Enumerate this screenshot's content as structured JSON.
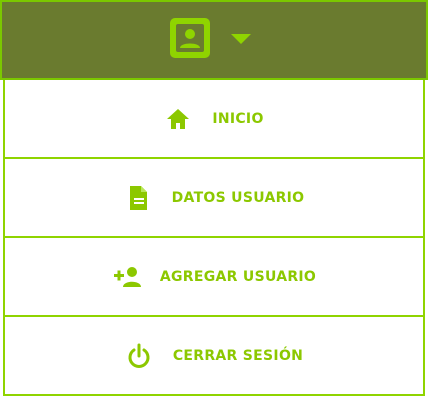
{
  "colors": {
    "header_bg": "#6a7b2f",
    "accent": "#8fd400",
    "label": "#8cc800",
    "background": "#ffffff"
  },
  "header": {
    "avatar_icon": "user-avatar-icon",
    "dropdown_icon": "chevron-down-icon"
  },
  "menu": {
    "items": [
      {
        "label": "INICIO",
        "icon": "home-icon"
      },
      {
        "label": "DATOS USUARIO",
        "icon": "document-icon"
      },
      {
        "label": "AGREGAR USUARIO",
        "icon": "add-user-icon"
      },
      {
        "label": "CERRAR SESIÓN",
        "icon": "power-icon"
      }
    ]
  }
}
